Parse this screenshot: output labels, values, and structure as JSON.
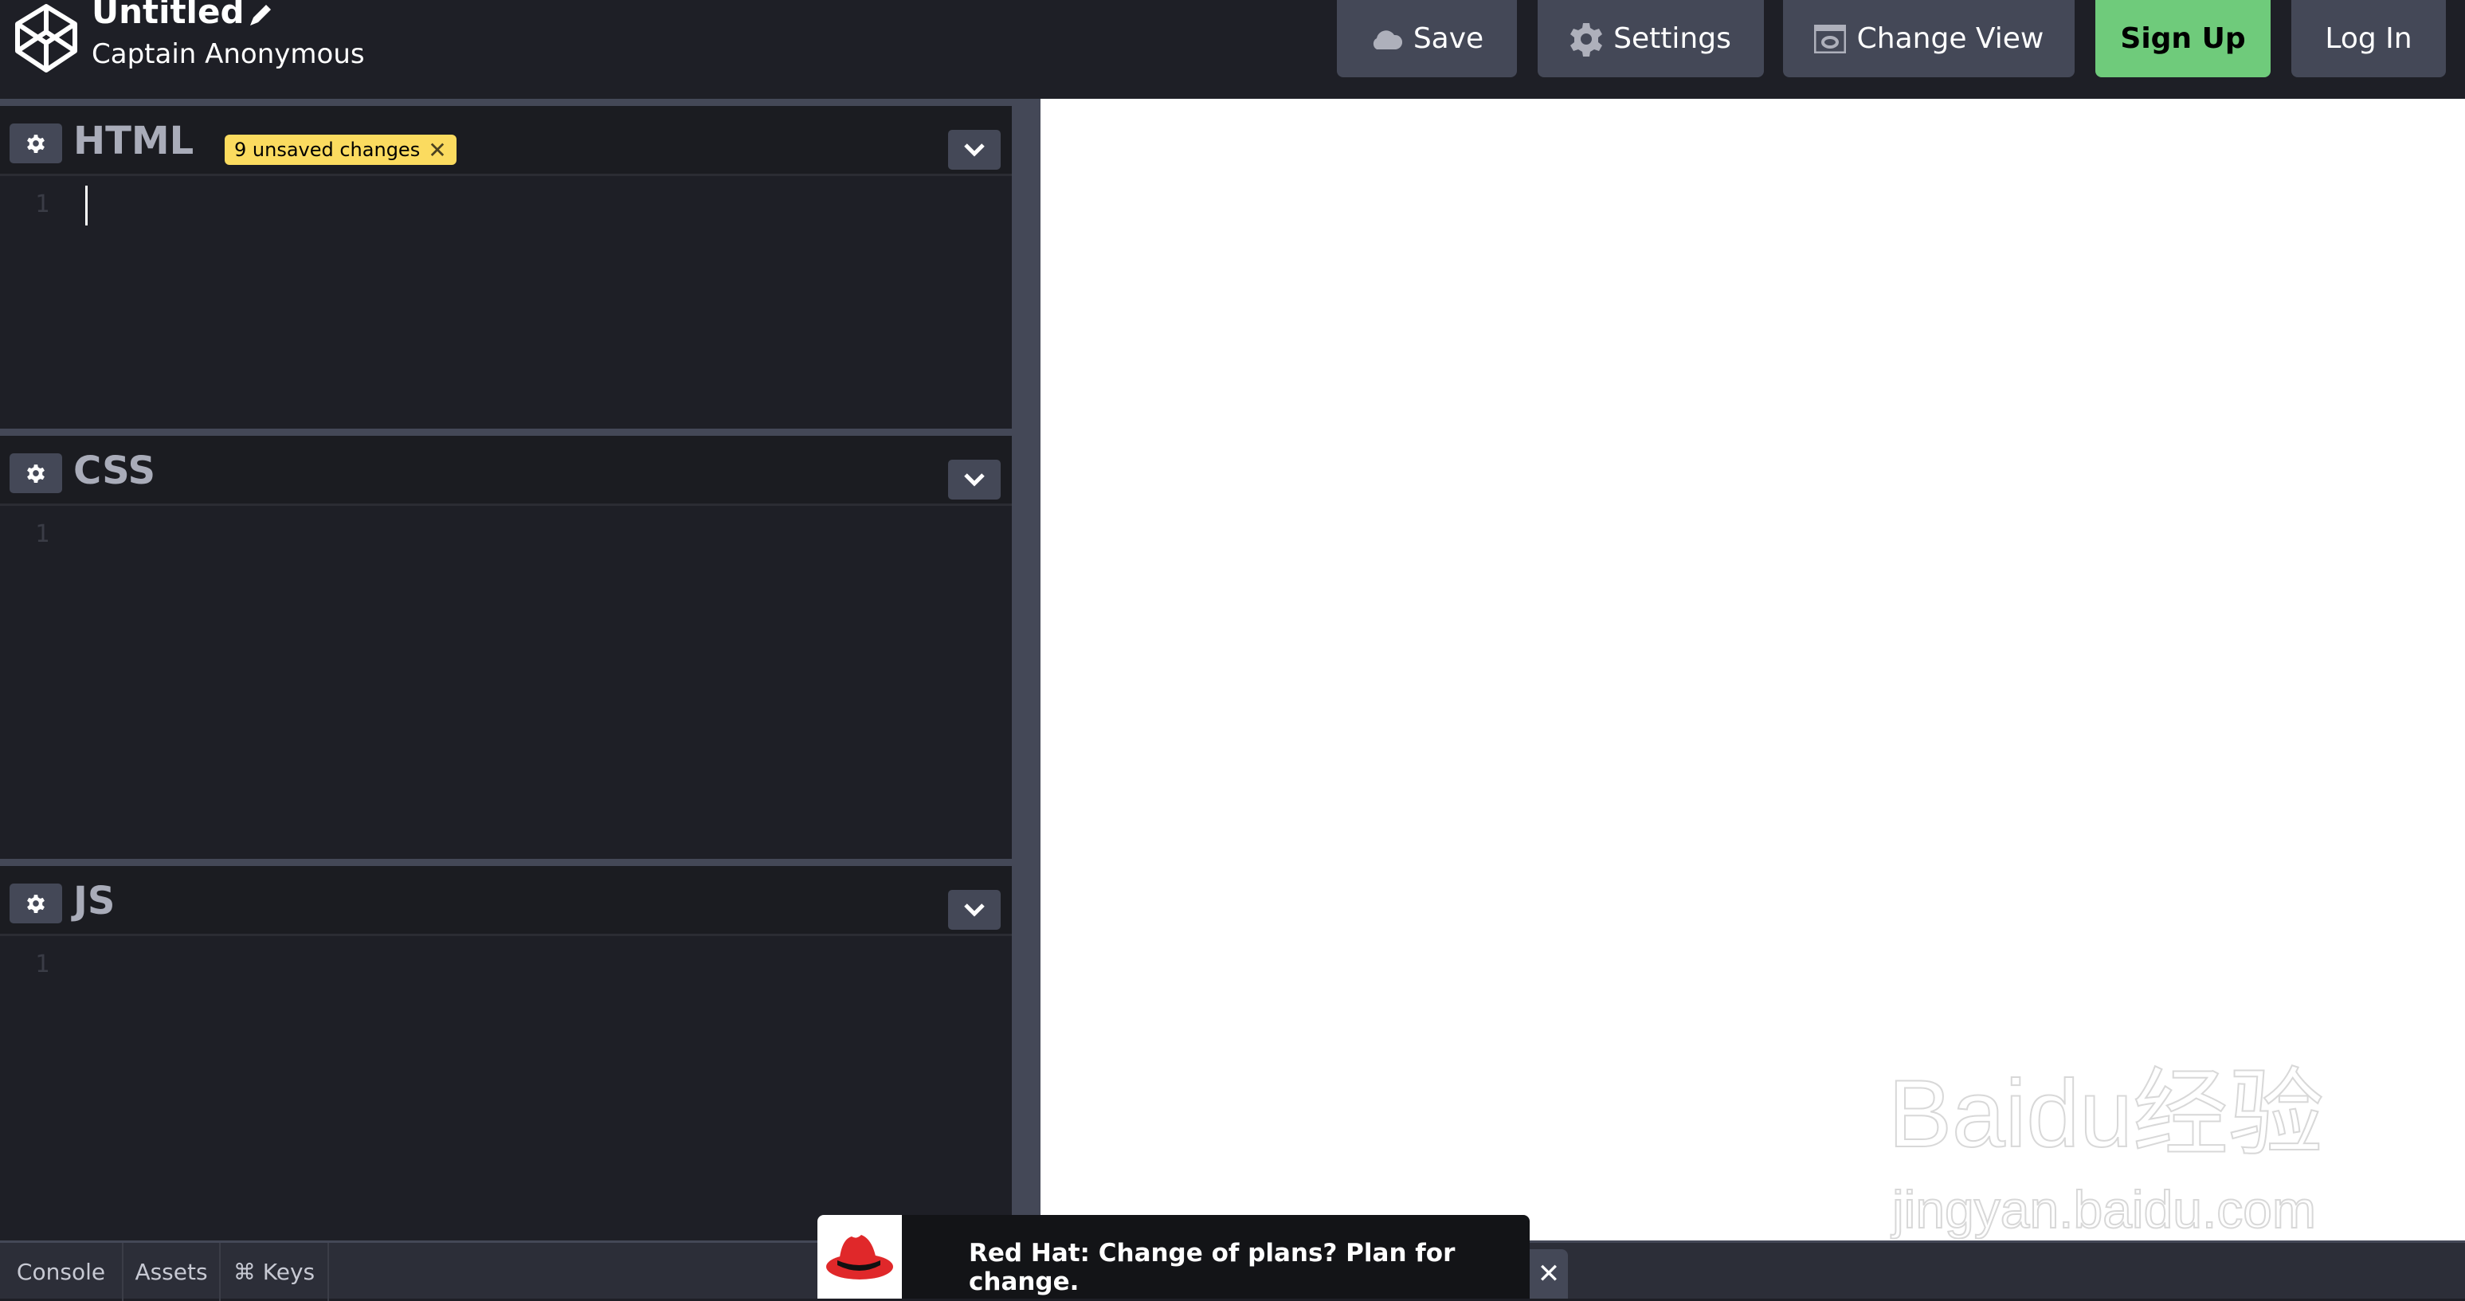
{
  "header": {
    "title": "Untitled",
    "user": "Captain Anonymous",
    "buttons": {
      "save": "Save",
      "settings": "Settings",
      "change_view": "Change View",
      "sign_up": "Sign Up",
      "log_in": "Log In"
    }
  },
  "editors": [
    {
      "label": "HTML",
      "badge": "9 unsaved changes",
      "badge_close": "✕",
      "line": "1"
    },
    {
      "label": "CSS",
      "line": "1"
    },
    {
      "label": "JS",
      "line": "1"
    }
  ],
  "bottom_tabs": [
    "Console",
    "Assets",
    "⌘ Keys"
  ],
  "ad": {
    "text": "Red Hat: Change of plans? Plan for change.",
    "close": "✕"
  },
  "watermark": {
    "line1": "Baidu经验",
    "line2": "jingyan.baidu.com"
  },
  "colors": {
    "accent_green": "#6fcb7b",
    "badge_yellow": "#fbdb5f",
    "button_bg": "#444857",
    "bg": "#1e1f26",
    "redhat_red": "#e0282a"
  }
}
